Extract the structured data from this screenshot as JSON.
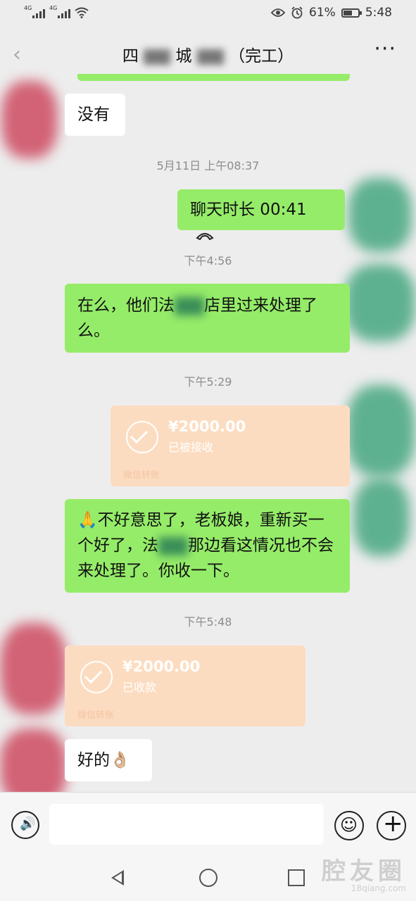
{
  "status_bar": {
    "sim1_label": "4G",
    "sim2_label": "4G",
    "battery_percent": "61%",
    "battery_level": 0.61,
    "time": "5:48",
    "icons": [
      "signal-icon",
      "wifi-icon",
      "eye-icon",
      "alarm-icon",
      "battery-icon"
    ]
  },
  "header": {
    "title_start": "四",
    "title_mid": "城",
    "title_end": "（完工）",
    "more_glyph": "···"
  },
  "messages": {
    "m1": "没有",
    "ts1": "5月11日 上午08:37",
    "call": "聊天时长 00:41",
    "ts2": "下午4:56",
    "m2_a": "在么，他们法",
    "m2_b": "店里过来处理了么。",
    "ts3": "下午5:29",
    "transfer1": {
      "amount": "¥2000.00",
      "status": "已被接收",
      "label": "微信转账"
    },
    "m3_a": "🙏不好意思了，老板娘，重新买一个好了，法",
    "m3_b": "那边看这情况也不会来处理了。你收一下。",
    "ts4": "下午5:48",
    "transfer2": {
      "amount": "¥2000.00",
      "status": "已收款",
      "label": "微信转账"
    },
    "m4": "好的👌🏼"
  },
  "input_bar": {
    "voice_glyph": "🔊",
    "emoji_glyph": "☺",
    "plus_glyph": "+"
  },
  "watermark": {
    "line1": "腔友圈",
    "line2": "18qiang.com"
  },
  "colors": {
    "background": "#ededed",
    "sent_bubble": "#95ec69",
    "received_bubble": "#ffffff",
    "transfer_bubble": "#fcdcc0"
  }
}
